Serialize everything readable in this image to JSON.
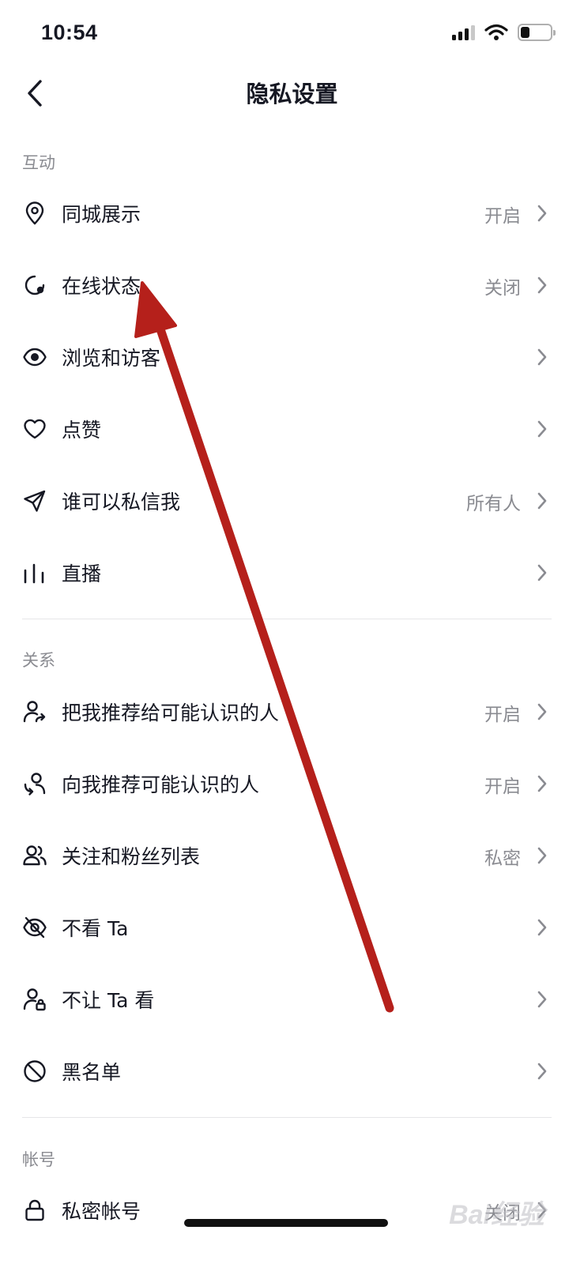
{
  "status_bar": {
    "time": "10:54"
  },
  "nav": {
    "title": "隐私设置"
  },
  "sections": {
    "interaction": {
      "header": "互动",
      "items": [
        {
          "label": "同城展示",
          "value": "开启",
          "icon": "location-pin-icon"
        },
        {
          "label": "在线状态",
          "value": "关闭",
          "icon": "online-status-icon"
        },
        {
          "label": "浏览和访客",
          "value": "",
          "icon": "eye-icon"
        },
        {
          "label": "点赞",
          "value": "",
          "icon": "heart-icon"
        },
        {
          "label": "谁可以私信我",
          "value": "所有人",
          "icon": "send-icon"
        },
        {
          "label": "直播",
          "value": "",
          "icon": "bars-icon"
        }
      ]
    },
    "relation": {
      "header": "关系",
      "items": [
        {
          "label": "把我推荐给可能认识的人",
          "value": "开启",
          "icon": "user-share-icon"
        },
        {
          "label": "向我推荐可能认识的人",
          "value": "开启",
          "icon": "user-recommend-icon"
        },
        {
          "label": "关注和粉丝列表",
          "value": "私密",
          "icon": "users-icon"
        },
        {
          "label": "不看 Ta",
          "value": "",
          "icon": "eye-off-icon"
        },
        {
          "label": "不让 Ta 看",
          "value": "",
          "icon": "user-lock-icon"
        },
        {
          "label": "黑名单",
          "value": "",
          "icon": "block-icon"
        }
      ]
    },
    "account": {
      "header": "帐号",
      "items": [
        {
          "label": "私密帐号",
          "value": "关闭",
          "icon": "lock-icon"
        }
      ]
    }
  },
  "watermark": {
    "text": "Bai经验"
  },
  "colors": {
    "annotation_arrow": "#b5201b",
    "text_primary": "#161823",
    "text_secondary": "#8a8b91"
  }
}
